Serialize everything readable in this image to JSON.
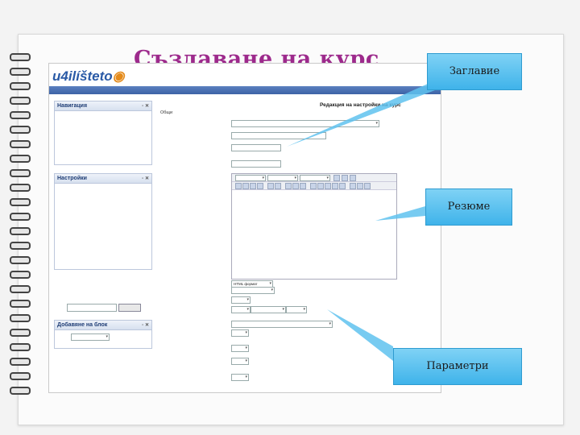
{
  "slide": {
    "title": "Създаване на курс",
    "callouts": {
      "title_box": "Заглавие",
      "summary_box": "Резюме",
      "params_box": "Параметри"
    }
  },
  "screenshot": {
    "logo_text": "u4ilíšteto",
    "breadcrumb": "",
    "nav_block": {
      "header": "Навигация",
      "items": [
        "",
        "",
        "",
        "",
        "",
        ""
      ]
    },
    "settings_block": {
      "header": "Настройки",
      "items": [
        "",
        "",
        "",
        "",
        "",
        "",
        "",
        ""
      ]
    },
    "add_block": {
      "header": "Добавяне на блок",
      "select": ""
    },
    "search_button": "",
    "form": {
      "title": "Редакция на настройки на курс",
      "section": "Общи",
      "fields": [
        {
          "label": "",
          "value": ""
        },
        {
          "label": "",
          "value": ""
        },
        {
          "label": "",
          "value": ""
        },
        {
          "label": "",
          "value": ""
        },
        {
          "label": "",
          "value": ""
        }
      ],
      "editor_format": "HTML формат",
      "params": [
        {
          "label": "",
          "value": ""
        },
        {
          "label": "",
          "value": ""
        },
        {
          "label": "",
          "value": ""
        },
        {
          "label": "",
          "value": ""
        },
        {
          "label": "",
          "value": ""
        },
        {
          "label": "",
          "value": ""
        },
        {
          "label": "",
          "value": ""
        },
        {
          "label": "",
          "value": ""
        },
        {
          "label": "",
          "value": ""
        }
      ]
    }
  },
  "colors": {
    "title": "#9d2a8c",
    "callout": "#3fb3ea",
    "header_bar": "#3d63a6"
  }
}
